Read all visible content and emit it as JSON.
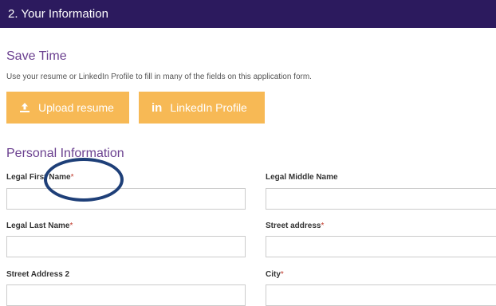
{
  "header": {
    "title": "2. Your Information"
  },
  "save_time": {
    "title": "Save Time",
    "helper": "Use your resume or LinkedIn Profile to fill in many of the fields on this application form.",
    "upload_label": "Upload resume",
    "linkedin_label": "LinkedIn Profile",
    "upload_icon": "upload-icon",
    "linkedin_icon": "linkedin-icon"
  },
  "personal": {
    "title": "Personal Information",
    "fields": {
      "first_name": {
        "label": "Legal First Name",
        "required": "*",
        "value": ""
      },
      "middle_name": {
        "label": "Legal Middle Name",
        "required": "",
        "value": ""
      },
      "last_name": {
        "label": "Legal Last Name",
        "required": "*",
        "value": ""
      },
      "street": {
        "label": "Street address",
        "required": "*",
        "value": ""
      },
      "street2": {
        "label": "Street Address 2",
        "required": "",
        "value": ""
      },
      "city": {
        "label": "City",
        "required": "*",
        "value": ""
      }
    }
  },
  "colors": {
    "header_bg": "#2c1a5e",
    "accent_purple": "#6a3f8f",
    "button_bg": "#f7b955",
    "required": "#c0392b",
    "annotation": "#1e3f78"
  }
}
